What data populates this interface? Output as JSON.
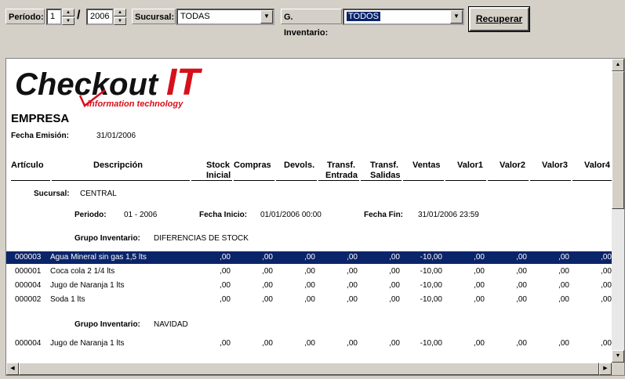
{
  "toolbar": {
    "periodo_label": "Período:",
    "periodo_month": "1",
    "periodo_year": "2006",
    "sucursal_label": "Sucursal:",
    "sucursal_value": "TODAS",
    "inventario_label": "G. Inventario:",
    "inventario_value": "TODOS",
    "recuperar_label": "Recuperar"
  },
  "report": {
    "logo_main": "Checkout",
    "logo_it": "IT",
    "logo_tagline": "information technology",
    "company": "EMPRESA",
    "fecha_emision_label": "Fecha Emisión:",
    "fecha_emision_value": "31/01/2006",
    "columns": {
      "articulo": "Artículo",
      "descripcion": "Descripción",
      "stock_1": "Stock",
      "stock_2": "Inicial",
      "compras": "Compras",
      "devols": "Devols.",
      "te_1": "Transf.",
      "te_2": "Entrada",
      "ts_1": "Transf.",
      "ts_2": "Salidas",
      "ventas": "Ventas",
      "valor1": "Valor1",
      "valor2": "Valor2",
      "valor3": "Valor3",
      "valor4": "Valor4"
    },
    "sucursal_label": "Sucursal:",
    "sucursal_value": "CENTRAL",
    "periodo_label": "Periodo:",
    "periodo_value": "01 - 2006",
    "fecha_inicio_label": "Fecha Inicio:",
    "fecha_inicio_value": "01/01/2006 00:00",
    "fecha_fin_label": "Fecha Fin:",
    "fecha_fin_value": "31/01/2006 23:59",
    "grupo_label": "Grupo Inventario:",
    "groups": [
      {
        "name": "DIFERENCIAS DE STOCK",
        "rows": [
          {
            "code": "000003",
            "desc": "Agua Mineral sin gas 1,5 lts",
            "stock": ",00",
            "compras": ",00",
            "devols": ",00",
            "te": ",00",
            "ts": ",00",
            "ventas": "-10,00",
            "v1": ",00",
            "v2": ",00",
            "v3": ",00",
            "v4": ",00"
          },
          {
            "code": "000001",
            "desc": "Coca cola 2 1/4 lts",
            "stock": ",00",
            "compras": ",00",
            "devols": ",00",
            "te": ",00",
            "ts": ",00",
            "ventas": "-10,00",
            "v1": ",00",
            "v2": ",00",
            "v3": ",00",
            "v4": ",00"
          },
          {
            "code": "000004",
            "desc": "Jugo de Naranja 1 lts",
            "stock": ",00",
            "compras": ",00",
            "devols": ",00",
            "te": ",00",
            "ts": ",00",
            "ventas": "-10,00",
            "v1": ",00",
            "v2": ",00",
            "v3": ",00",
            "v4": ",00"
          },
          {
            "code": "000002",
            "desc": "Soda 1 lts",
            "stock": ",00",
            "compras": ",00",
            "devols": ",00",
            "te": ",00",
            "ts": ",00",
            "ventas": "-10,00",
            "v1": ",00",
            "v2": ",00",
            "v3": ",00",
            "v4": ",00"
          }
        ]
      },
      {
        "name": "NAVIDAD",
        "rows": [
          {
            "code": "000004",
            "desc": "Jugo de Naranja 1 lts",
            "stock": ",00",
            "compras": ",00",
            "devols": ",00",
            "te": ",00",
            "ts": ",00",
            "ventas": "-10,00",
            "v1": ",00",
            "v2": ",00",
            "v3": ",00",
            "v4": ",00"
          }
        ]
      }
    ]
  },
  "colors": {
    "face": "#d4d0c8",
    "selection": "#0a246a",
    "logo_black": "#111111",
    "logo_red": "#d6101a"
  }
}
